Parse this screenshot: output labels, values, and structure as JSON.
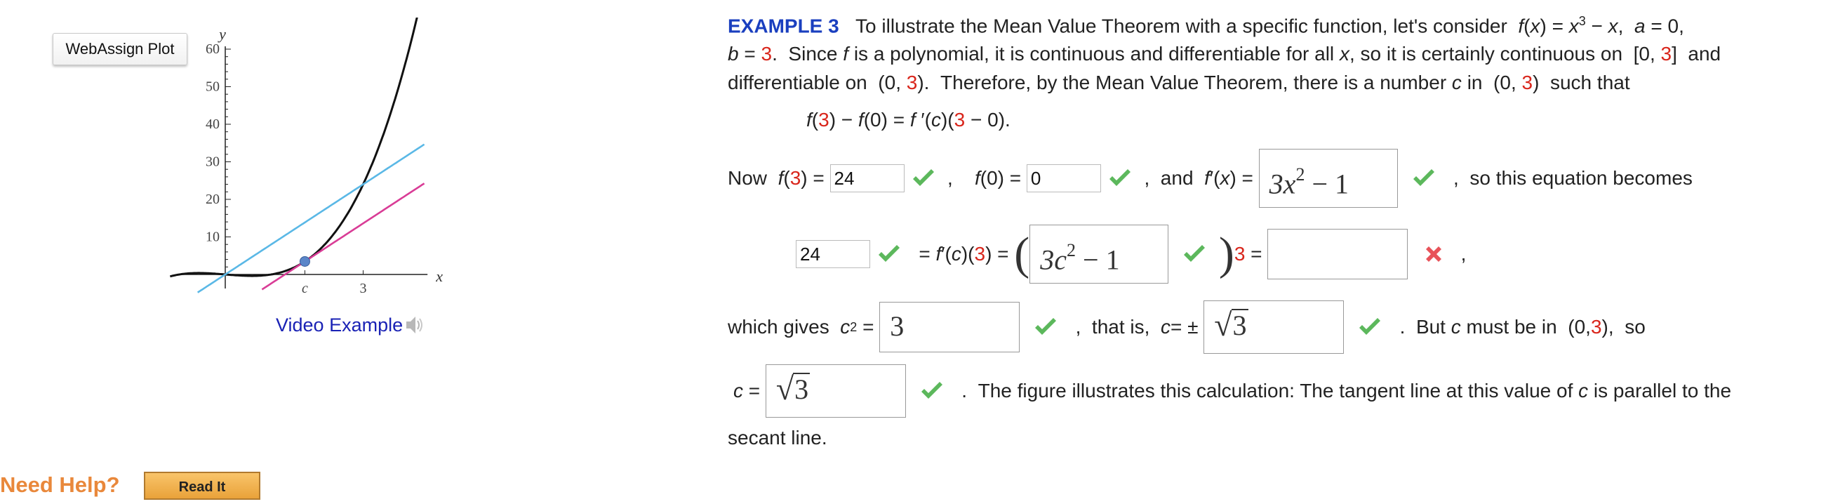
{
  "plot_button": {
    "label": "WebAssign Plot"
  },
  "video_example": {
    "label": "Video Example"
  },
  "help": {
    "label": "Need Help?",
    "button": "Read It"
  },
  "chart_data": {
    "type": "line",
    "xlabel": "x",
    "ylabel": "y",
    "ylim": [
      -3,
      60
    ],
    "xlim": [
      -1.2,
      4.4
    ],
    "yticks": [
      10,
      20,
      30,
      40,
      50,
      60
    ],
    "xtick_labels": [
      {
        "value": 1.732,
        "label": "c"
      },
      {
        "value": 3,
        "label": "3"
      }
    ],
    "series": [
      {
        "function": "x^3 - x",
        "x_range": [
          -1.2,
          4.33
        ],
        "color": "#111111"
      },
      {
        "function": "8x",
        "x_range": [
          -0.6,
          4.33
        ],
        "color": "#5ab8e6"
      },
      {
        "function": "2x(x - 1.732) + 3.46",
        "x_range": [
          0.8,
          4.33
        ],
        "color": "#d93c96"
      }
    ],
    "point": {
      "x": 1.732,
      "y": 3.464,
      "color": "#5b86c9"
    },
    "grid": false
  },
  "example": {
    "heading": "EXAMPLE 3",
    "line1_a": "To illustrate the Mean Value Theorem with a specific function, let's consider",
    "line1_b": "and differentiable for all",
    "line2_tail": "so it is certainly continuous on",
    "line3": "Therefore, by the Mean Value Theorem, there is a number",
    "such_that": "such that",
    "since": "Since",
    "is_poly": "is a polynomial, it is continuous",
    "now": "Now",
    "and": "and",
    "so_eq": "so this equation becomes",
    "which_gives": "which gives",
    "that_is": "that is,",
    "but": "But",
    "must_be_in": "must be in",
    "so": "so",
    "figure_text": "The figure illustrates this calculation: The tangent line at this value of",
    "is_parallel": "is parallel to the",
    "secant": "secant line."
  },
  "answers": {
    "f3": "24",
    "f0": "0",
    "fprime": "3x",
    "fprime_exp": "2",
    "fprime_tail": " − 1",
    "left_val": "24",
    "fc_deriv": "3c",
    "fc_exp": "2",
    "fc_tail": " − 1",
    "eq_result": "",
    "c_squared": "3",
    "c_sqrt": "3",
    "c_final": "3"
  }
}
